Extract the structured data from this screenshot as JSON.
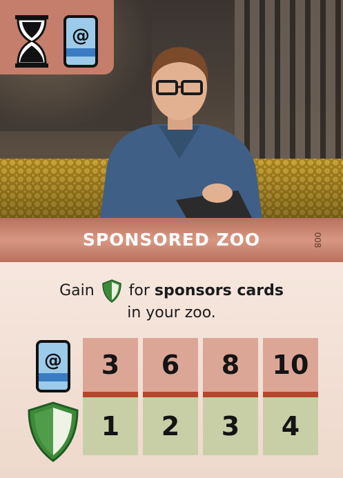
{
  "card": {
    "title": "SPONSORED ZOO",
    "number": "008",
    "rule_prefix": "Gain",
    "rule_bold": "sponsors cards",
    "rule_suffix": "for",
    "rule_line2": "in your zoo.",
    "icons": {
      "hourglass": "hourglass-icon",
      "sponsor": "sponsor-card-icon",
      "shield": "shield-icon"
    },
    "colors": {
      "badge": "#c47e6b",
      "title_band": "#c8826f",
      "top_cell": "#dba696",
      "bottom_cell": "#c8cfa6",
      "divider": "#b4472e",
      "shield_green": "#3d8a3a"
    }
  },
  "table": {
    "columns": [
      {
        "sponsors": "3",
        "points": "1"
      },
      {
        "sponsors": "6",
        "points": "2"
      },
      {
        "sponsors": "8",
        "points": "3"
      },
      {
        "sponsors": "10",
        "points": "4"
      }
    ]
  }
}
